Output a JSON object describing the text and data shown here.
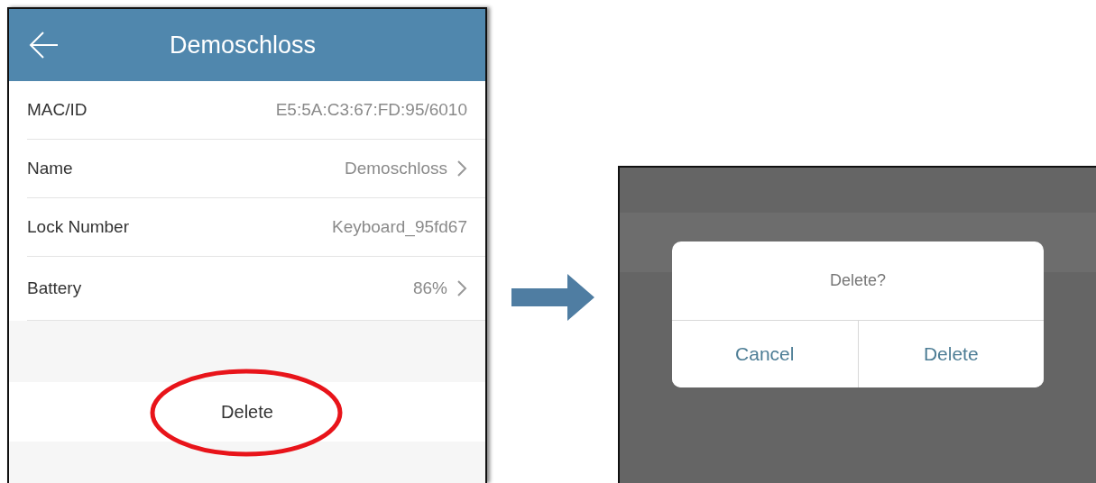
{
  "detail_screen": {
    "title": "Demoschloss",
    "rows": [
      {
        "label": "MAC/ID",
        "value": "E5:5A:C3:67:FD:95/6010",
        "chevron": false
      },
      {
        "label": "Name",
        "value": "Demoschloss",
        "chevron": true
      },
      {
        "label": "Lock Number",
        "value": "Keyboard_95fd67",
        "chevron": false
      },
      {
        "label": "Battery",
        "value": "86%",
        "chevron": true
      }
    ],
    "delete_button": {
      "label": "Delete",
      "circled": true
    }
  },
  "confirm_dialog": {
    "message": "Delete?",
    "buttons": [
      {
        "label": "Cancel"
      },
      {
        "label": "Delete"
      }
    ]
  }
}
